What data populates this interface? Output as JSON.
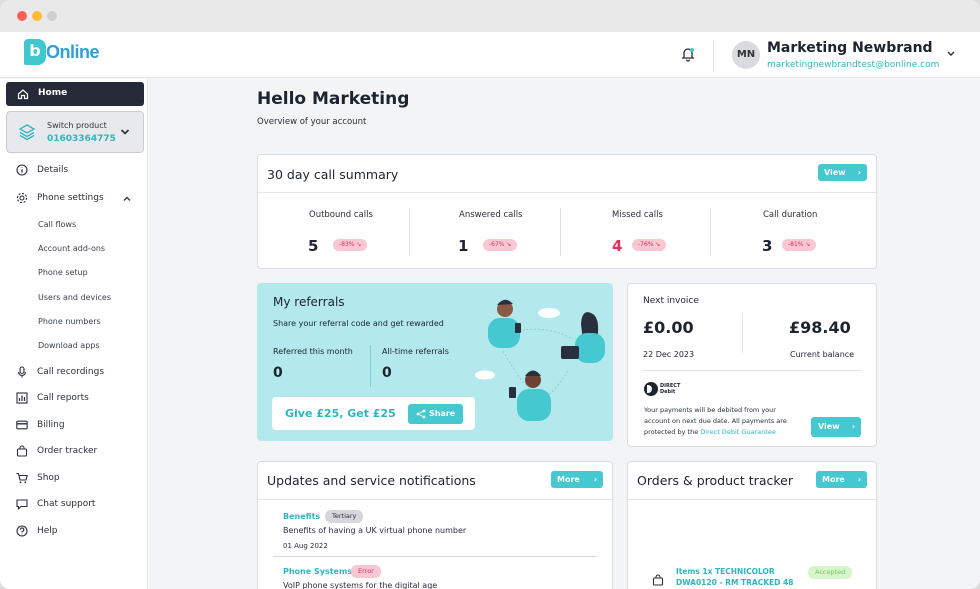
{
  "brand": {
    "logo_letter": "b",
    "logo_text": "Online",
    "color": "#45c8cf"
  },
  "user": {
    "initials": "MN",
    "name": "Marketing Newbrand",
    "email": "marketingnewbrandtest@bonline.com"
  },
  "sidebar": {
    "home": "Home",
    "switch_product": {
      "label": "Switch product",
      "number": "01603364775"
    },
    "items": [
      {
        "label": "Details",
        "icon": "info-icon"
      },
      {
        "label": "Phone settings",
        "icon": "gear-icon"
      }
    ],
    "phone_settings_sub": [
      "Call flows",
      "Account add-ons",
      "Phone setup",
      "Users and devices",
      "Phone numbers",
      "Download apps"
    ],
    "items_after": [
      {
        "label": "Call recordings",
        "icon": "microphone-icon"
      },
      {
        "label": "Call reports",
        "icon": "chart-icon"
      },
      {
        "label": "Billing",
        "icon": "card-icon"
      },
      {
        "label": "Order tracker",
        "icon": "bag-icon"
      },
      {
        "label": "Shop",
        "icon": "cart-icon"
      },
      {
        "label": "Chat support",
        "icon": "chat-icon"
      },
      {
        "label": "Help",
        "icon": "help-icon"
      }
    ]
  },
  "main": {
    "title": "Hello Marketing",
    "subtitle": "Overview of your account"
  },
  "call_summary": {
    "title": "30 day call summary",
    "view_label": "View",
    "stats": [
      {
        "label": "Outbound calls",
        "value": "5",
        "change": "-83% ↘"
      },
      {
        "label": "Answered calls",
        "value": "1",
        "change": "-67% ↘"
      },
      {
        "label": "Missed calls",
        "value": "4",
        "change": "-76% ↘"
      },
      {
        "label": "Call duration",
        "value": "3",
        "change": "-81% ↘"
      }
    ]
  },
  "referrals": {
    "title": "My referrals",
    "subtitle": "Share your referral code and get rewarded",
    "month_label": "Referred this month",
    "month_value": "0",
    "all_label": "All-time referrals",
    "all_value": "0",
    "offer": "Give £25, Get £25",
    "share_label": "Share"
  },
  "invoice": {
    "title": "Next invoice",
    "amount": "£0.00",
    "date": "22 Dec 2023",
    "balance": "£98.40",
    "balance_label": "Current balance",
    "dd_logo": "DIRECT Debit",
    "note": "Your payments will be debited from your account on next due date. All payments are protected by the",
    "note_link": "Direct Debit Guarantee",
    "view_label": "View"
  },
  "updates": {
    "title": "Updates and service notifications",
    "more_label": "More",
    "items": [
      {
        "link": "Benefits",
        "tag": "Tertiary",
        "text": "Benefits of having a UK virtual phone number",
        "date": "01 Aug 2022"
      },
      {
        "link": "Phone Systems",
        "tag": "Error",
        "text": "VoIP phone systems for the digital age"
      }
    ]
  },
  "orders": {
    "title": "Orders & product tracker",
    "more_label": "More",
    "item": "Items 1x TECHNICOLOR DWA0120 - RM TRACKED 48",
    "status": "Accepted"
  }
}
